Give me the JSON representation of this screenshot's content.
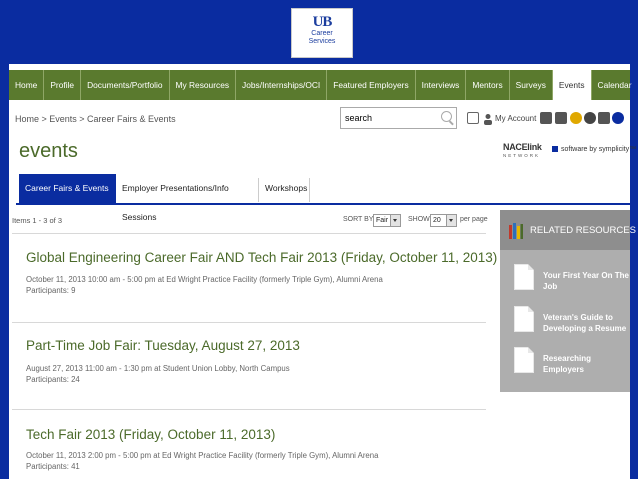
{
  "header": {
    "logo_mark": "UB",
    "logo_line1": "Career",
    "logo_line2": "Services"
  },
  "nav": {
    "items": [
      "Home",
      "Profile",
      "Documents/Portfolio",
      "My Resources",
      "Jobs/Internships/OCI",
      "Featured Employers",
      "Interviews",
      "Mentors",
      "Surveys",
      "Events",
      "Calendar"
    ],
    "active": "Events"
  },
  "breadcrumb": "Home > Events > Career Fairs & Events",
  "search": {
    "value": "search"
  },
  "toolbar": {
    "my_account": "My Account"
  },
  "page_title": "events",
  "branding": {
    "nace": "NACElink",
    "nace_sub": "NETWORK",
    "symplicity": "software by symplicity™"
  },
  "tabs": [
    "Career Fairs & Events",
    "Employer Presentations/Info Sessions",
    "Workshops"
  ],
  "list": {
    "items_count": "Items 1 - 3 of 3",
    "sort_label": "SORT BY:",
    "sort_value": "Fair",
    "show_label": "SHOW",
    "show_value": "20",
    "per_page": "per page"
  },
  "events": [
    {
      "title": "Global Engineering Career Fair AND Tech Fair 2013 (Friday, October 11, 2013)",
      "detail": "October 11, 2013 10:00 am - 5:00 pm at Ed Wright Practice Facility (formerly Triple Gym), Alumni Arena",
      "participants": "Participants: 9"
    },
    {
      "title": "Part-Time Job Fair: Tuesday, August 27, 2013",
      "detail": "August 27, 2013 11:00 am - 1:30 pm at Student Union Lobby, North Campus",
      "participants": "Participants: 24"
    },
    {
      "title": "Tech Fair 2013 (Friday, October 11, 2013)",
      "detail": "October 11, 2013 2:00 pm - 5:00 pm at Ed Wright Practice Facility (formerly Triple Gym), Alumni Arena",
      "participants": "Participants: 41"
    }
  ],
  "related": {
    "title": "RELATED RESOURCES",
    "links": [
      "Your First Year On The Job",
      "Veteran's Guide to Developing a Resume",
      "Researching Employers"
    ]
  },
  "colors": {
    "header_blue": "#0a2ca0",
    "nav_green": "#5a7a2e",
    "title_green": "#4b6a2a",
    "panel_gray": "#aeaeae"
  },
  "icons": [
    "print-icon",
    "user-icon",
    "facebook-icon",
    "linkedin-icon",
    "help-icon",
    "settings-icon",
    "printer-icon",
    "info-icon"
  ]
}
